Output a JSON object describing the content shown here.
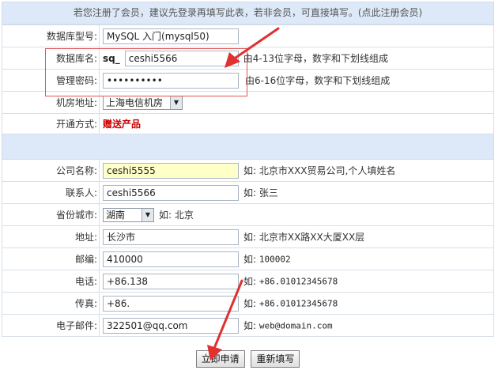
{
  "notice": "若您注册了会员，建议先登录再填写此表，若非会员，可直接填写。(点此注册会员)",
  "db": {
    "type_label": "数据库型号:",
    "type_value": "MySQL 入门(mysql50)",
    "name_label": "数据库名:",
    "name_prefix": "sq_",
    "name_value": "ceshi5566",
    "name_hint": "由4-13位字母，数字和下划线组成",
    "password_label": "管理密码:",
    "password_value": "••••••••••",
    "password_hint": "由6-16位字母，数字和下划线组成",
    "room_label": "机房地址:",
    "room_value": "上海电信机房",
    "mode_label": "开通方式:",
    "mode_value": "赠送产品"
  },
  "contact": {
    "company_label": "公司名称:",
    "company_value": "ceshi5555",
    "company_hint": "如: 北京市XXX贸易公司,个人填姓名",
    "person_label": "联系人:",
    "person_value": "ceshi5566",
    "person_hint": "如: 张三",
    "city_label": "省份城市:",
    "city_value": "湖南",
    "city_hint": "如: 北京",
    "address_label": "地址:",
    "address_value": "长沙市",
    "address_hint": "如: 北京市XX路XX大厦XX层",
    "zip_label": "邮编:",
    "zip_value": "410000",
    "zip_hint_prefix": "如:",
    "zip_hint": "100002",
    "phone_label": "电话:",
    "phone_value": "+86.138",
    "phone_hint_prefix": "如:",
    "phone_hint": "+86.01012345678",
    "fax_label": "传真:",
    "fax_value": "+86.",
    "fax_hint_prefix": "如:",
    "fax_hint": "+86.01012345678",
    "email_label": "电子邮件:",
    "email_value": "322501@qq.com",
    "email_hint_prefix": "如:",
    "email_hint": "web@domain.com"
  },
  "buttons": {
    "submit": "立即申请",
    "reset": "重新填写"
  },
  "colors": {
    "accent_red": "#cc0000",
    "annotation_red": "#e03030",
    "header_bg": "#dde9f8"
  }
}
